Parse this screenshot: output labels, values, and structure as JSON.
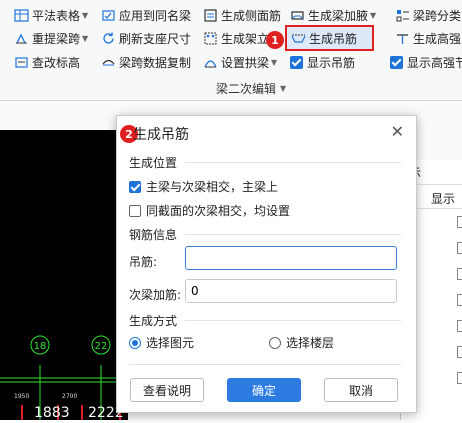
{
  "ribbon": {
    "row1": {
      "pingfa": "平法表格",
      "apply_same": "应用到同名梁",
      "gen_side": "生成侧面筋",
      "gen_haunch": "生成梁加腋",
      "span_class": "梁跨分类"
    },
    "row2": {
      "re_extract": "重提梁跨",
      "refresh_support": "刷新支座尺寸",
      "gen_erect": "生成架立",
      "gen_hanger": "生成吊筋",
      "gen_high": "生成高强"
    },
    "row3": {
      "check_elev": "查改标高",
      "copy_span": "梁跨数据复制",
      "set_arch": "设置拱梁",
      "show_hanger": "显示吊筋",
      "show_high": "显示高强节"
    },
    "group_label": "梁二次编辑",
    "badge1": "1"
  },
  "panel": {
    "tab_label": "示",
    "column_header": "显示"
  },
  "canvas": {
    "axis_labels": [
      "18",
      "22"
    ],
    "dims": [
      "1950",
      "2700"
    ],
    "bottom_labels": [
      "1883",
      "2222"
    ]
  },
  "dialog": {
    "badge": "2",
    "title": "生成吊筋",
    "close": "✕",
    "section_position": "生成位置",
    "opt_main_secondary": "主梁与次梁相交，主梁上",
    "opt_same_section": "同截面的次梁相交，均设置",
    "section_rebar": "钢筋信息",
    "label_hanger": "吊筋:",
    "hanger_value": "",
    "label_secondary": "次梁加筋:",
    "secondary_value": "0",
    "section_method": "生成方式",
    "radio_select_elem": "选择图元",
    "radio_select_floor": "选择楼层",
    "btn_help": "查看说明",
    "btn_ok": "确定",
    "btn_cancel": "取消"
  }
}
